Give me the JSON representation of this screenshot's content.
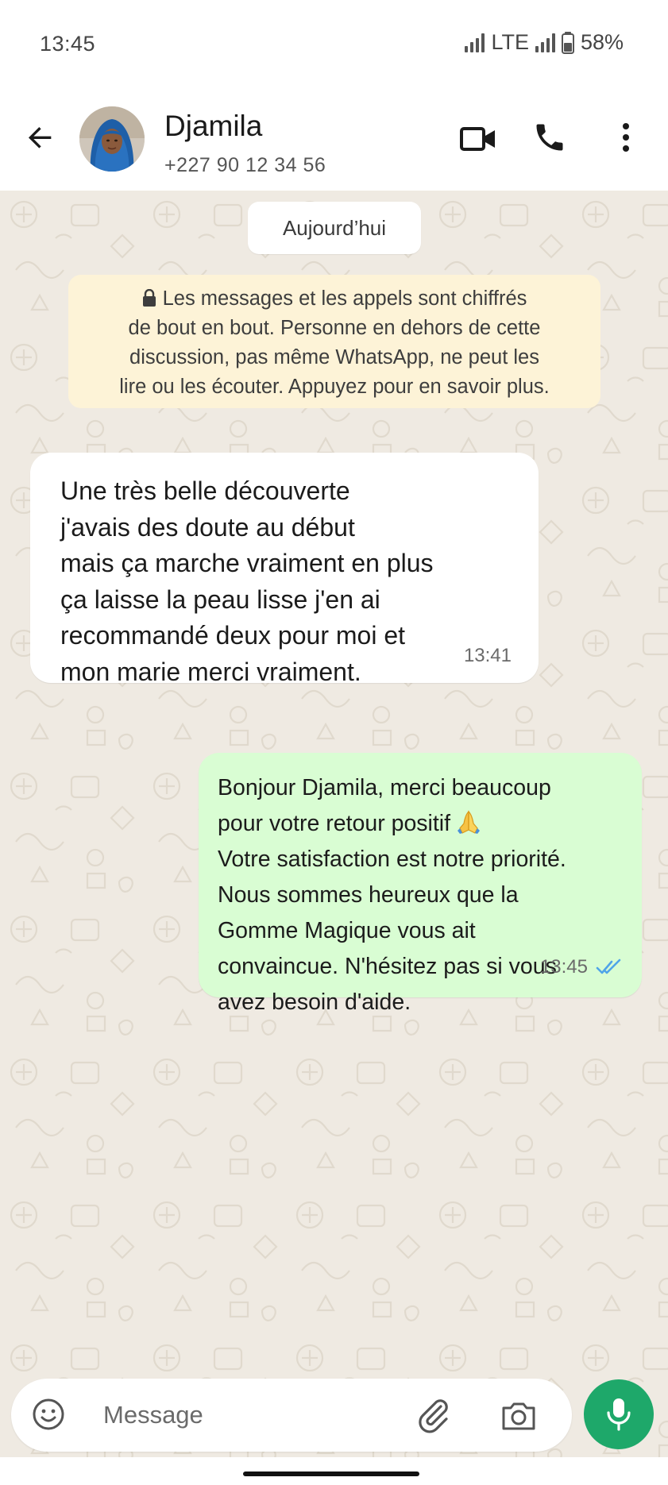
{
  "status_bar": {
    "time": "13:45",
    "network": "LTE",
    "battery": "58%",
    "battery_level": 0.58
  },
  "header": {
    "contact_name": "Djamila",
    "contact_phone": "+227 90 12 34 56",
    "icons": [
      "back-arrow-icon",
      "video-call-icon",
      "phone-icon",
      "more-vert-icon"
    ]
  },
  "chat": {
    "date_chip": "Aujourd’hui",
    "encryption_notice": {
      "lines": [
        "Les messages et les appels sont chiffrés",
        "de bout en bout. Personne en dehors de cette",
        "discussion, pas même WhatsApp, ne peut les",
        "lire ou les écouter. Appuyez pour en savoir plus."
      ]
    },
    "messages": [
      {
        "direction": "incoming",
        "lines": [
          "Une très belle découverte",
          "j'avais des doute au début",
          "mais ça marche vraiment en plus",
          "ça laisse la peau lisse j'en ai",
          "recommandé deux pour moi et",
          "mon marie merci vraiment."
        ],
        "time": "13:41"
      },
      {
        "direction": "outgoing",
        "lines": [
          "Bonjour Djamila, merci beaucoup",
          "pour votre retour positif",
          "Votre satisfaction est notre priorité.",
          "Nous sommes heureux que la",
          "Gomme Magique vous ait",
          "convaincue. N'hésitez pas si vous",
          "avez besoin d'aide."
        ],
        "emoji": "folded-hands",
        "time": "13:45",
        "status": "read"
      }
    ]
  },
  "composer": {
    "placeholder": "Message",
    "value": "",
    "icons": [
      "emoji-icon",
      "attach-icon",
      "camera-icon",
      "mic-icon"
    ]
  },
  "colors": {
    "chat_background": "#efeae2",
    "outgoing_bubble": "#d9fdd3",
    "incoming_bubble": "#ffffff",
    "notice_background": "#fdf3d7",
    "accent_green": "#1ea86a",
    "read_ticks": "#4fa4e8"
  }
}
